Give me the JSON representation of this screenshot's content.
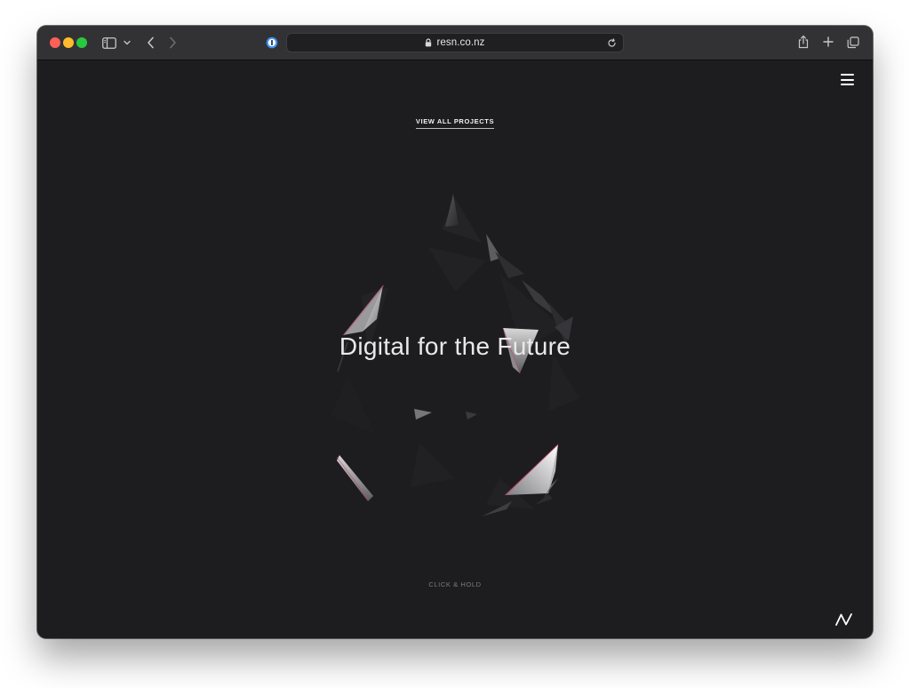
{
  "browser": {
    "url": "resn.co.nz"
  },
  "page": {
    "view_all_projects_label": "VIEW ALL PROJECTS",
    "hero_title": "Digital for the Future",
    "click_hold_label": "CLICK & HOLD"
  },
  "colors": {
    "page_background": "#1d1d1f",
    "toolbar_background": "#323234",
    "text_primary": "#e9e9e9",
    "text_muted": "#7c7c7f"
  },
  "icons": {
    "toolbar": [
      "sidebar-icon",
      "chevron-down-icon",
      "back-arrow-icon",
      "forward-arrow-icon",
      "password-manager-icon",
      "lock-icon",
      "reload-icon",
      "share-icon",
      "new-tab-icon",
      "tab-overview-icon"
    ],
    "page": [
      "hamburger-menu-icon",
      "resn-logo-icon"
    ]
  }
}
